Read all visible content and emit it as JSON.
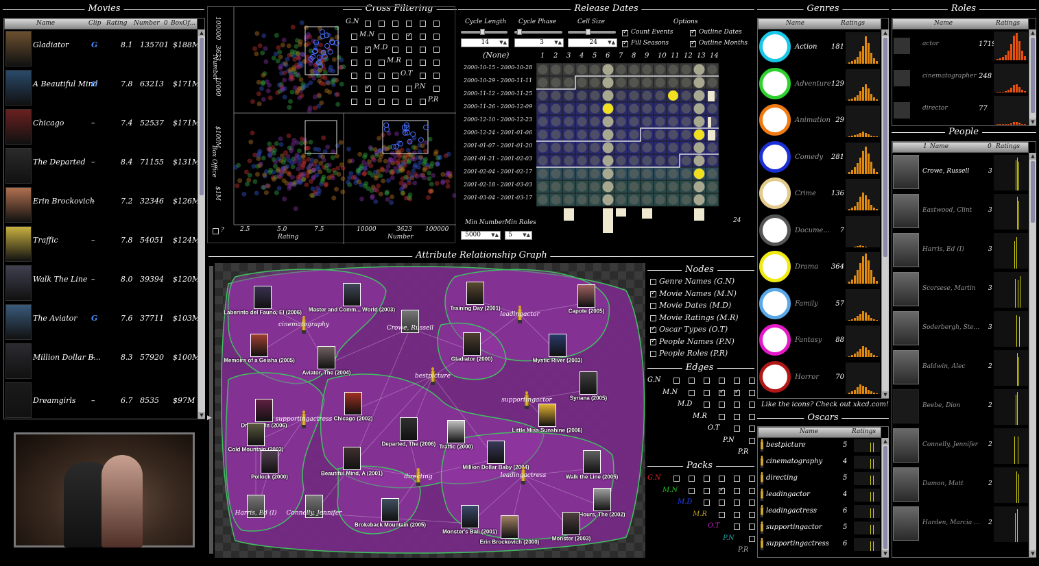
{
  "panels": {
    "movies": "Movies",
    "cross": "Cross Filtering",
    "release": "Release Dates",
    "genres": "Genres",
    "roles": "Roles",
    "people": "People",
    "arg": "Attribute Relationship Graph",
    "nodes": "Nodes",
    "edges": "Edges",
    "packs": "Packs",
    "oscars": "Oscars"
  },
  "movies": {
    "headers": [
      "Name",
      "Clip",
      "Rating",
      "Number",
      "0",
      "BoxOf..."
    ],
    "rows": [
      {
        "name": "Gladiator",
        "clip": "G",
        "rating": "8.1",
        "number": "135701",
        "box": "$188M"
      },
      {
        "name": "A Beautiful Mind",
        "clip": "G",
        "rating": "7.8",
        "number": "63213",
        "box": "$171M"
      },
      {
        "name": "Chicago",
        "clip": "–",
        "rating": "7.4",
        "number": "52537",
        "box": "$171M"
      },
      {
        "name": "The Departed",
        "clip": "–",
        "rating": "8.4",
        "number": "71155",
        "box": "$131M"
      },
      {
        "name": "Erin Brockovich",
        "clip": "–",
        "rating": "7.2",
        "number": "32346",
        "box": "$126M"
      },
      {
        "name": "Traffic",
        "clip": "–",
        "rating": "7.8",
        "number": "54051",
        "box": "$124M"
      },
      {
        "name": "Walk The Line",
        "clip": "–",
        "rating": "8.0",
        "number": "39394",
        "box": "$120M"
      },
      {
        "name": "The Aviator",
        "clip": "G",
        "rating": "7.6",
        "number": "37711",
        "box": "$103M"
      },
      {
        "name": "Million Dollar B...",
        "clip": "–",
        "rating": "8.3",
        "number": "57920",
        "box": "$100M"
      },
      {
        "name": "Dreamgirls",
        "clip": "–",
        "rating": "6.7",
        "number": "8535",
        "box": "$97M"
      }
    ]
  },
  "scatter": {
    "ytop": [
      "100000",
      "3623",
      "10000"
    ],
    "ytop_label": "Number",
    "ybot": [
      "$100M",
      "$1M"
    ],
    "ybot_label": "Box Office",
    "xleft": [
      "2.5",
      "5.0",
      "7.5"
    ],
    "xleft_label": "Rating",
    "xright": [
      "10000",
      "3623",
      "100000"
    ],
    "xright_label": "Number",
    "q": "?"
  },
  "crossfilter": {
    "labels": [
      "G.N",
      "M.N",
      "M.D",
      "M.R",
      "O.T",
      "P.N",
      "P.R"
    ]
  },
  "release": {
    "cycle_length_label": "Cycle Length",
    "cycle_phase_label": "Cycle Phase",
    "cell_size_label": "Cell Size",
    "options_label": "Options",
    "cycle_length": "14",
    "cycle_phase": "3",
    "cell_size": "24",
    "opt1": "Count Events",
    "opt2": "Outline Dates",
    "opt3": "Fill Seasons",
    "opt4": "Outline Months",
    "none": "(None)",
    "cols": [
      "1",
      "2",
      "3",
      "4",
      "5",
      "6",
      "7",
      "8",
      "9",
      "10",
      "11",
      "12",
      "13",
      "14"
    ],
    "rows": [
      "2000-10-15 - 2000-10-28",
      "2000-10-29 - 2000-11-11",
      "2000-11-12 - 2000-11-25",
      "2000-11-26 - 2000-12-09",
      "2000-12-10 - 2000-12-23",
      "2000-12-24 - 2001-01-06",
      "2001-01-07 - 2001-01-20",
      "2001-01-21 - 2001-02-03",
      "2001-02-04 - 2001-02-17",
      "2001-02-18 - 2001-03-03",
      "2001-03-04 - 2001-03-17"
    ],
    "min_number_label": "Min Number",
    "min_roles_label": "Min Roles",
    "min_number": "5000",
    "min_roles": "5",
    "count": "24"
  },
  "genres": {
    "headers": [
      "Name",
      "Ratings"
    ],
    "items": [
      {
        "name": "Action",
        "count": "181",
        "color": "#19c7e6"
      },
      {
        "name": "Adventure",
        "count": "129",
        "color": "#2fd12f"
      },
      {
        "name": "Animation",
        "count": "29",
        "color": "#f07a12"
      },
      {
        "name": "Comedy",
        "count": "281",
        "color": "#1a2fd6"
      },
      {
        "name": "Crime",
        "count": "136",
        "color": "#e3c98a"
      },
      {
        "name": "Docume...",
        "count": "7",
        "color": "#555555"
      },
      {
        "name": "Drama",
        "count": "364",
        "color": "#f0ea12"
      },
      {
        "name": "Family",
        "count": "57",
        "color": "#5aa8e8"
      },
      {
        "name": "Fantasy",
        "count": "88",
        "color": "#e619c9"
      },
      {
        "name": "Horror",
        "count": "70",
        "color": "#b01818"
      }
    ],
    "footer": "Like the icons? Check out xkcd.com!"
  },
  "roles": {
    "headers": [
      "Name",
      "Ratings"
    ],
    "items": [
      {
        "name": "actor",
        "count": "1719"
      },
      {
        "name": "cinematographer",
        "count": "248"
      },
      {
        "name": "director",
        "count": "77"
      }
    ]
  },
  "people": {
    "headers": [
      "1",
      "Name",
      "0",
      "Ratings"
    ],
    "items": [
      {
        "name": "Crowe, Russell",
        "count": "3"
      },
      {
        "name": "Eastwood, Clint",
        "count": "3"
      },
      {
        "name": "Harris, Ed (I)",
        "count": "3"
      },
      {
        "name": "Scorsese, Martin",
        "count": "3"
      },
      {
        "name": "Soderbergh, Ste...",
        "count": "3"
      },
      {
        "name": "Baldwin, Alec",
        "count": "2"
      },
      {
        "name": "Beebe, Dion",
        "count": "2"
      },
      {
        "name": "Connelly, Jennifer",
        "count": "2"
      },
      {
        "name": "Damon, Matt",
        "count": "2"
      },
      {
        "name": "Harden, Marcia ...",
        "count": "2"
      }
    ]
  },
  "graph": {
    "movies": [
      {
        "label": "Laberinto del Fauno, El (2006)"
      },
      {
        "label": "Master and Comm... World (2003)"
      },
      {
        "label": "Training Day (2001)"
      },
      {
        "label": "Capote (2005)"
      },
      {
        "label": "Memoirs of a Geisha (2005)"
      },
      {
        "label": "Aviator, The (2004)"
      },
      {
        "label": "Gladiator (2000)"
      },
      {
        "label": "Mystic River (2003)"
      },
      {
        "label": "Dreamgirls (2006)"
      },
      {
        "label": "Chicago (2002)"
      },
      {
        "label": "Syriana (2005)"
      },
      {
        "label": "Little Miss Sunshine (2006)"
      },
      {
        "label": "Cold Mountain (2003)"
      },
      {
        "label": "Departed, The (2006)"
      },
      {
        "label": "Traffic (2000)"
      },
      {
        "label": "Pollock (2000)"
      },
      {
        "label": "Beautiful Mind, A (2001)"
      },
      {
        "label": "Million Dollar Baby (2004)"
      },
      {
        "label": "Walk the Line (2005)"
      },
      {
        "label": "Hours, The (2002)"
      },
      {
        "label": "Brokeback Mountain (2005)"
      },
      {
        "label": "Monster's Ball (2001)"
      },
      {
        "label": "Erin Brockovich (2000)"
      },
      {
        "label": "Monster (2003)"
      }
    ],
    "oscars": [
      "cinematography",
      "leadingactor",
      "bestpicture",
      "supportingactor",
      "supportingactress",
      "directing",
      "leadingactress"
    ],
    "people": [
      "Crowe, Russell",
      "Harris, Ed (I)",
      "Connelly, Jennifer"
    ]
  },
  "nodes": {
    "items": [
      {
        "label": "Genre Names (G.N)",
        "checked": false
      },
      {
        "label": "Movie Names (M.N)",
        "checked": true
      },
      {
        "label": "Movie Dates (M.D)",
        "checked": false
      },
      {
        "label": "Movie Ratings (M.R)",
        "checked": false
      },
      {
        "label": "Oscar Types (O.T)",
        "checked": true
      },
      {
        "label": "People Names (P.N)",
        "checked": true
      },
      {
        "label": "People Roles (P.R)",
        "checked": false
      }
    ]
  },
  "edges": {
    "labels": [
      "G.N",
      "M.N",
      "M.D",
      "M.R",
      "O.T",
      "P.N",
      "P.R"
    ]
  },
  "packs": {
    "labels": [
      "G.N",
      "M.N",
      "M.D",
      "M.R",
      "O.T",
      "P.N",
      "P.R"
    ],
    "colors": [
      "#e02020",
      "#20c020",
      "#2040ff",
      "#c0a020",
      "#c020c0",
      "#20a0a0",
      "#aaaaaa"
    ]
  },
  "oscars": {
    "headers": [
      "Name",
      "Ratings"
    ],
    "items": [
      {
        "name": "bestpicture",
        "count": "5"
      },
      {
        "name": "cinematography",
        "count": "4"
      },
      {
        "name": "directing",
        "count": "5"
      },
      {
        "name": "leadingactor",
        "count": "4"
      },
      {
        "name": "leadingactress",
        "count": "6"
      },
      {
        "name": "supportingactor",
        "count": "5"
      },
      {
        "name": "supportingactress",
        "count": "6"
      }
    ]
  }
}
